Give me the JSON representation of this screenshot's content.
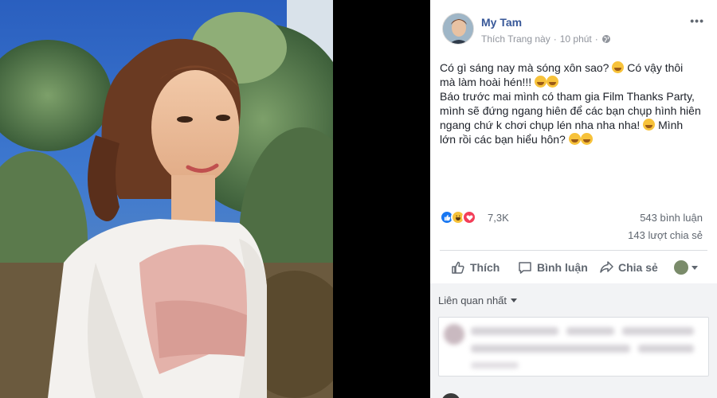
{
  "post": {
    "author": "My Tam",
    "page_action": "Thích Trang này",
    "separator": "·",
    "time": "10 phút",
    "text_lines": [
      "Có gì sáng nay mà sóng xôn sao?",
      "Có vậy thôi",
      "mà làm hoài hén!!!",
      "Báo trước mai mình có tham gia Film Thanks Party,",
      "mình sẽ đứng ngang hiên để các bạn chụp hình hiên",
      "ngang chứ k chơi chụp lén nha nha nha!",
      "Mình",
      "lớn rồi các bạn hiểu hôn?"
    ]
  },
  "reactions": {
    "count": "7,3K",
    "comments": "543 bình luận",
    "shares": "143 lượt chia sẻ",
    "types": [
      "like-icon",
      "haha-icon",
      "love-icon"
    ]
  },
  "actions": {
    "like": "Thích",
    "comment": "Bình luận",
    "share": "Chia sẻ"
  },
  "comments": {
    "sort": "Liên quan nhất"
  },
  "colors": {
    "link": "#385898",
    "meta": "#90949c",
    "like": "#1877f2",
    "love": "#f33e58",
    "haha": "#f7c23a"
  }
}
